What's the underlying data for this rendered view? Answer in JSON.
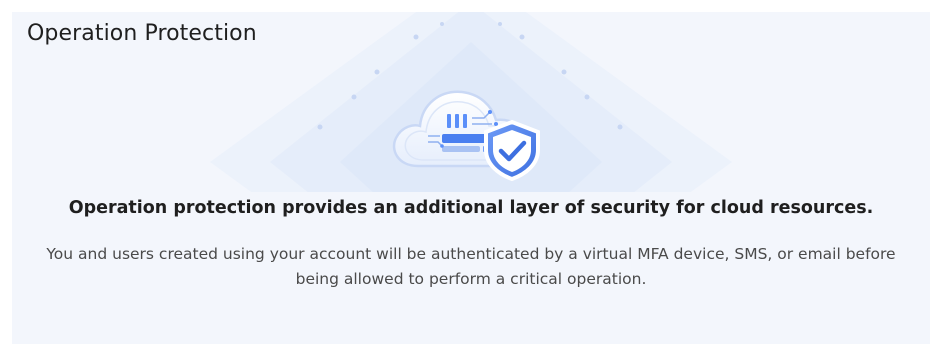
{
  "card": {
    "title": "Operation Protection",
    "headline": "Operation protection provides an additional layer of security for cloud resources.",
    "description": "You and users created using your account will be authenticated by a virtual MFA device, SMS, or email before being allowed to perform a critical operation."
  },
  "illustration": {
    "icons": [
      "cloud-icon",
      "shield-check-icon"
    ]
  },
  "colors": {
    "panel_background": "#f3f6fc",
    "accent_blue": "#5b8ff9",
    "title_text": "#1f1f1f",
    "body_text": "#4a4a4a"
  }
}
